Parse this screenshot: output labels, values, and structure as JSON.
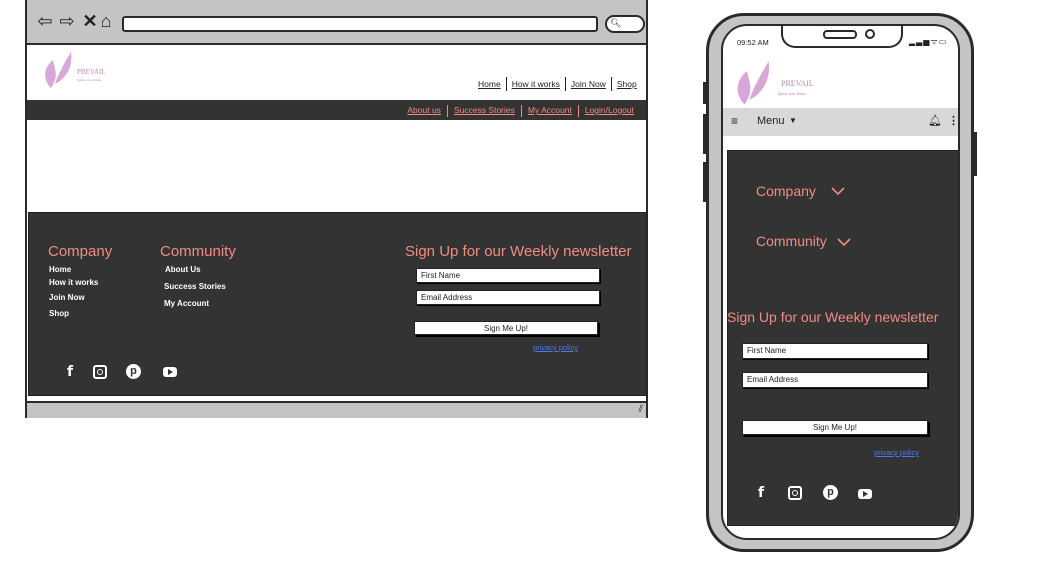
{
  "desktop": {
    "browser": {
      "url": ""
    },
    "logo": {
      "brand": "PREVAIL",
      "tagline": "Ignite your flame"
    },
    "top_nav": [
      "Home",
      "How it works",
      "Join Now",
      "Shop"
    ],
    "sub_nav": [
      "About us",
      "Success Stories",
      "My Account",
      "Login/Logout"
    ],
    "footer": {
      "company": {
        "heading": "Company",
        "links": [
          "Home",
          "How it works",
          "Join Now",
          "Shop"
        ]
      },
      "community": {
        "heading": "Community",
        "links": [
          "About Us",
          "Success Stories",
          "My Account"
        ]
      },
      "newsletter": {
        "heading": "Sign Up for our Weekly newsletter",
        "first_name": "First Name",
        "email": "Email Address",
        "button": "Sign Me Up!",
        "privacy": "privacy policy"
      }
    }
  },
  "mobile": {
    "status_time": "09:52 AM",
    "logo": {
      "brand": "PREVAIL",
      "tagline": "Ignite your flame"
    },
    "menu_label": "Menu",
    "footer": {
      "company_heading": "Company",
      "community_heading": "Community",
      "newsletter": {
        "heading": "Sign Up for our Weekly newsletter",
        "first_name": "First Name",
        "email": "Email Address",
        "button": "Sign Me Up!",
        "privacy": "privacy policy"
      }
    }
  },
  "colors": {
    "accent": "#f28b82",
    "dark": "#333333",
    "logo": "#d9a6d8",
    "link_blue": "#4c7bf0"
  },
  "icons": [
    "back-arrow-icon",
    "forward-arrow-icon",
    "close-icon",
    "home-icon",
    "search-icon",
    "facebook-icon",
    "instagram-icon",
    "pinterest-icon",
    "youtube-icon",
    "hamburger-icon",
    "bell-icon",
    "more-vertical-icon",
    "chevron-down-icon",
    "signal-icon",
    "wifi-icon",
    "battery-icon",
    "resize-grip-icon"
  ]
}
